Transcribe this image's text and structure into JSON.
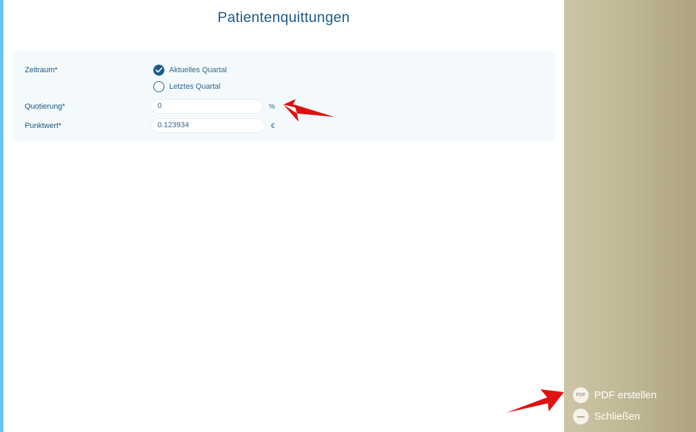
{
  "title": "Patientenquittungen",
  "form": {
    "zeitraum_label": "Zeitraum*",
    "options": [
      {
        "label": "Aktuelles Quartal",
        "selected": true
      },
      {
        "label": "Letztes Quartal",
        "selected": false
      }
    ],
    "quotierung_label": "Quotierung*",
    "quotierung_value": "0",
    "quotierung_unit": "%",
    "punktwert_label": "Punktwert*",
    "punktwert_value": "0.123934",
    "punktwert_unit": "€"
  },
  "sidebar": {
    "pdf_icon_text": "PDF",
    "pdf_label": "PDF erstellen",
    "close_label": "Schließen"
  },
  "colors": {
    "accent": "#1d5d8a",
    "left_strip": "#6cc4e8",
    "sidebar": "#c0b794",
    "annotation_arrow": "#e01010"
  }
}
